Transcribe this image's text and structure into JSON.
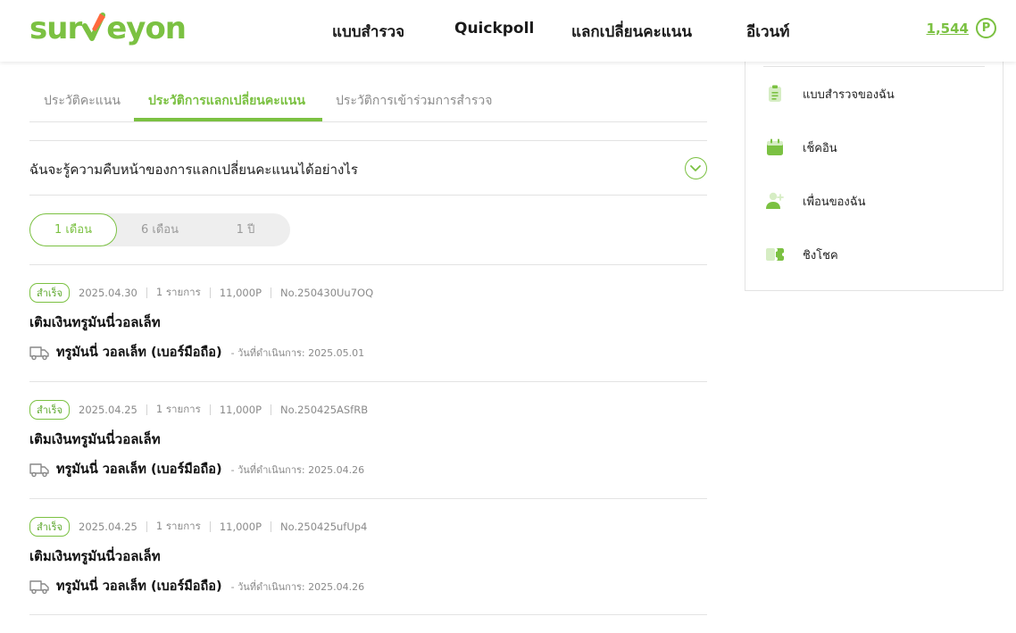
{
  "header": {
    "logo_text": "surveyon",
    "nav": [
      "แบบสำรวจ",
      "Quickpoll",
      "แลกเปลี่ยนคะแนน",
      "อีเวนท์"
    ],
    "points": "1,544",
    "points_icon": "P"
  },
  "tabs": [
    "ประวัติคะแนน",
    "ประวัติการแลกเปลี่ยนคะแนน",
    "ประวัติการเข้าร่วมการสำรวจ"
  ],
  "active_tab": 1,
  "faq": {
    "question": "ฉันจะรู้ความคืบหน้าของการแลกเปลี่ยนคะแนนได้อย่างไร"
  },
  "periods": [
    "1 เดือน",
    "6 เดือน",
    "1 ปี"
  ],
  "active_period": 0,
  "items": [
    {
      "status": "สำเร็จ",
      "date": "2025.04.30",
      "count": "1 รายการ",
      "points": "11,000P",
      "number": "No.250430Uu7OQ",
      "title": "เติมเงินทรูมันนี่วอลเล็ท",
      "product": "ทรูมันนี่ วอลเล็ท (เบอร์มือถือ)",
      "processed": "- วันที่ดำเนินการ: 2025.05.01"
    },
    {
      "status": "สำเร็จ",
      "date": "2025.04.25",
      "count": "1 รายการ",
      "points": "11,000P",
      "number": "No.250425ASfRB",
      "title": "เติมเงินทรูมันนี่วอลเล็ท",
      "product": "ทรูมันนี่ วอลเล็ท (เบอร์มือถือ)",
      "processed": "- วันที่ดำเนินการ: 2025.04.26"
    },
    {
      "status": "สำเร็จ",
      "date": "2025.04.25",
      "count": "1 รายการ",
      "points": "11,000P",
      "number": "No.250425ufUp4",
      "title": "เติมเงินทรูมันนี่วอลเล็ท",
      "product": "ทรูมันนี่ วอลเล็ท (เบอร์มือถือ)",
      "processed": "- วันที่ดำเนินการ: 2025.04.26"
    }
  ],
  "sidebar": [
    {
      "label": "แบบสำรวจของฉัน",
      "icon": "clipboard-icon"
    },
    {
      "label": "เช็คอิน",
      "icon": "calendar-icon"
    },
    {
      "label": "เพื่อนของฉัน",
      "icon": "add-friend-icon"
    },
    {
      "label": "ชิงโชค",
      "icon": "ticket-icon"
    }
  ],
  "colors": {
    "accent": "#7bc142",
    "text": "#111111",
    "muted": "#8a8a8a",
    "border": "#e3e3e3"
  }
}
